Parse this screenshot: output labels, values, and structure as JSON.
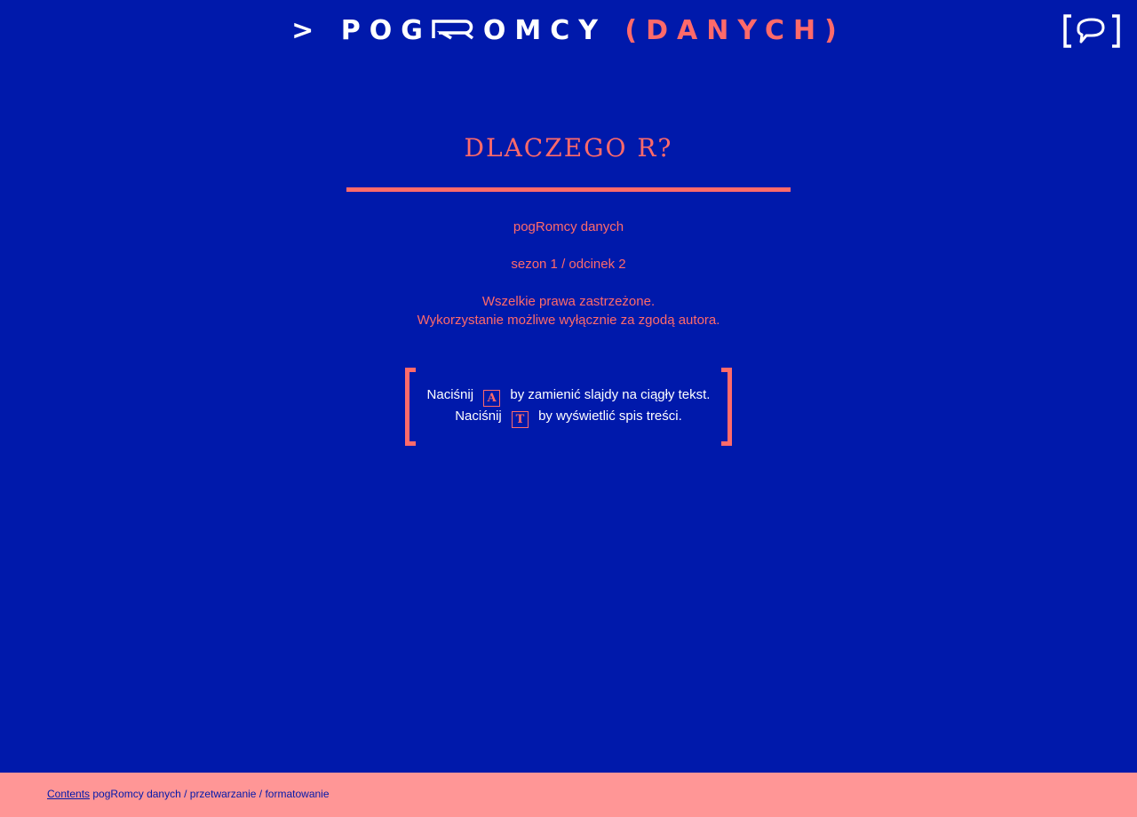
{
  "header": {
    "logo_prompt": ">",
    "logo_brand_start": "POG",
    "logo_brand_end": "OMCY",
    "logo_paren_text": "(DANYCH)",
    "chat_icon": "speech-bubble-icon"
  },
  "slide": {
    "title": "DLACZEGO R?",
    "series_name": "pogRomcy danych",
    "episode": "sezon 1 / odcinek 2",
    "rights_line1": "Wszelkie prawa zastrzeżone.",
    "rights_line2": "Wykorzystanie możliwe wyłącznie za zgodą autora."
  },
  "hints": {
    "line1_prefix": "Naciśnij",
    "line1_key": "A",
    "line1_suffix": "by zamienić slajdy na ciągły tekst.",
    "line2_prefix": "Naciśnij",
    "line2_key": "T",
    "line2_suffix": "by wyświetlić spis treści."
  },
  "footer": {
    "contents_link": "Contents",
    "breadcrumb": "pogRomcy danych / przetwarzanie / formatowanie"
  },
  "colors": {
    "background": "#0019ab",
    "accent": "#ff6a6a",
    "footer_bg": "#ff9696",
    "text_light": "#ffffff"
  }
}
